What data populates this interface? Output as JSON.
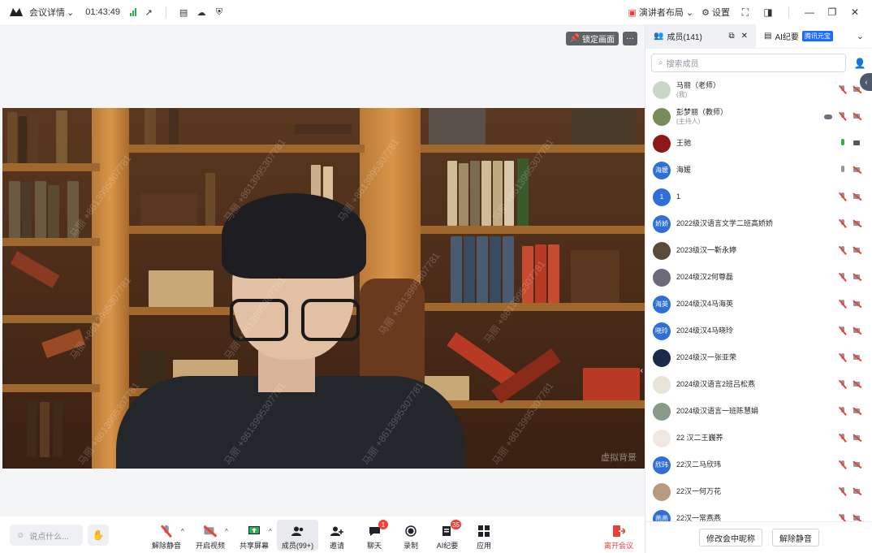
{
  "topbar": {
    "meeting_details_label": "会议详情",
    "elapsed_time": "01:43:49",
    "speaker_layout_label": "演讲者布局",
    "settings_label": "设置"
  },
  "stage": {
    "lock_screen_label": "锁定画面",
    "virtual_background_label": "虚拟背景",
    "watermark_text": "马丽 +8613995307781"
  },
  "toolbar": {
    "chat_placeholder": "说点什么...",
    "unmute_label": "解除静音",
    "start_video_label": "开启视频",
    "share_screen_label": "共享屏幕",
    "members_label": "成员(99+)",
    "invite_label": "邀请",
    "chat_label": "聊天",
    "chat_badge": "1",
    "record_label": "录制",
    "ai_minutes_label": "AI纪要",
    "ai_badge": "35",
    "apps_label": "应用",
    "leave_label": "离开会议"
  },
  "panel": {
    "members_tab": "成员(141)",
    "ai_tab": "AI纪要",
    "ai_tab_badge": "腾讯元宝",
    "search_placeholder": "搜索成员",
    "rename_button": "修改会中昵称",
    "unmute_button": "解除静音",
    "members": [
      {
        "name": "马丽（老师）",
        "role": "(我)",
        "avatar_text": "",
        "avatar_color": "#c9d6c9",
        "mic": "off",
        "cam": "off"
      },
      {
        "name": "彭梦丽（教师）",
        "role": "(主持人)",
        "avatar_text": "",
        "avatar_color": "#7a8a5a",
        "mic": "off",
        "cam": "off",
        "cloud": true
      },
      {
        "name": "王驰",
        "role": "",
        "avatar_text": "",
        "avatar_color": "#8a1a1a",
        "mic": "on",
        "cam": "on"
      },
      {
        "name": "海媛",
        "role": "",
        "avatar_text": "海媛",
        "avatar_color": "#2f6fd6",
        "mic": "grey",
        "cam": "off"
      },
      {
        "name": "1",
        "role": "",
        "avatar_text": "1",
        "avatar_color": "#2f6fd6",
        "mic": "off",
        "cam": "off"
      },
      {
        "name": "2022级汉语言文学二班高娇娇",
        "role": "",
        "avatar_text": "娇娇",
        "avatar_color": "#2f6fd6",
        "mic": "off",
        "cam": "off"
      },
      {
        "name": "2023级汉一靳永婷",
        "role": "",
        "avatar_text": "",
        "avatar_color": "#5a4a3a",
        "mic": "off",
        "cam": "off"
      },
      {
        "name": "2024级汉2何尊磊",
        "role": "",
        "avatar_text": "",
        "avatar_color": "#6a6a7a",
        "mic": "off",
        "cam": "off"
      },
      {
        "name": "2024级汉4马海英",
        "role": "",
        "avatar_text": "海英",
        "avatar_color": "#2f6fd6",
        "mic": "off",
        "cam": "off"
      },
      {
        "name": "2024级汉4马晓玲",
        "role": "",
        "avatar_text": "晓玲",
        "avatar_color": "#2f6fd6",
        "mic": "off",
        "cam": "off"
      },
      {
        "name": "2024级汉一张亚荣",
        "role": "",
        "avatar_text": "",
        "avatar_color": "#1a2a4a",
        "mic": "off",
        "cam": "off"
      },
      {
        "name": "2024级汉语言2班吕松燕",
        "role": "",
        "avatar_text": "",
        "avatar_color": "#e8e4d8",
        "mic": "off",
        "cam": "off"
      },
      {
        "name": "2024级汉语言一班陈慧娟",
        "role": "",
        "avatar_text": "",
        "avatar_color": "#8a9a8a",
        "mic": "off",
        "cam": "off"
      },
      {
        "name": "22 汉二王巍荞",
        "role": "",
        "avatar_text": "",
        "avatar_color": "#f0e8e0",
        "mic": "off",
        "cam": "off"
      },
      {
        "name": "22汉二马欣玮",
        "role": "",
        "avatar_text": "欣玮",
        "avatar_color": "#2f6fd6",
        "mic": "off",
        "cam": "off"
      },
      {
        "name": "22汉一何万花",
        "role": "",
        "avatar_text": "",
        "avatar_color": "#b89a80",
        "mic": "off",
        "cam": "off"
      },
      {
        "name": "22汉一常燕燕",
        "role": "",
        "avatar_text": "燕燕",
        "avatar_color": "#2f6fd6",
        "mic": "off",
        "cam": "off"
      }
    ]
  }
}
